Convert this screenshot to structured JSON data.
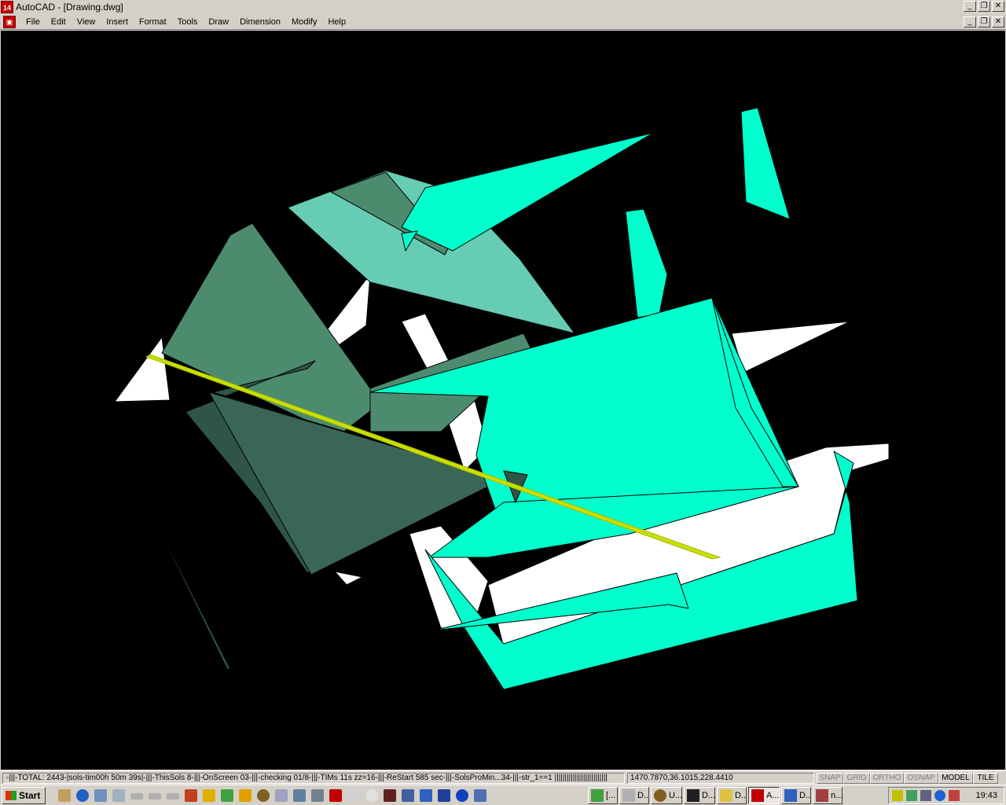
{
  "window": {
    "app_icon_text": "14",
    "title": "AutoCAD - [Drawing.dwg]",
    "controls": {
      "minimize": "_",
      "restore": "❐",
      "close": "✕"
    }
  },
  "menu": {
    "items": [
      {
        "label": "File"
      },
      {
        "label": "Edit"
      },
      {
        "label": "View"
      },
      {
        "label": "Insert"
      },
      {
        "label": "Format"
      },
      {
        "label": "Tools"
      },
      {
        "label": "Draw"
      },
      {
        "label": "Dimension"
      },
      {
        "label": "Modify"
      },
      {
        "label": "Help"
      }
    ]
  },
  "viewport": {
    "background": "#000000",
    "colors": {
      "cyan": "#00ffcc",
      "light_teal": "#66ccb3",
      "medium_green": "#4d8b6f",
      "dark_green": "#2f5546",
      "white": "#ffffff",
      "yellow_green": "#c8e000"
    }
  },
  "status": {
    "message": "-|||-TOTAL: 2443-|sols-tim00h 50m 39s|-|||-ThisSols 8-|||-OnScreen 03-|||-checking 01/8-|||-TIMs 11s zz=16-|||-ReStart 585 sec-|||-SolsProMin...34-|||-str_1==1 ||||||||||||||||||||||||||",
    "coords": "1470.7870,36.1015,228.4410",
    "toggles": [
      {
        "label": "SNAP",
        "on": false
      },
      {
        "label": "GRID",
        "on": false
      },
      {
        "label": "ORTHO",
        "on": false
      },
      {
        "label": "OSNAP",
        "on": false
      },
      {
        "label": "MODEL",
        "on": true
      },
      {
        "label": "TILE",
        "on": true
      }
    ]
  },
  "taskbar": {
    "start_label": "Start",
    "tasks": [
      {
        "label": "[..."
      },
      {
        "label": "D..."
      },
      {
        "label": "U..."
      },
      {
        "label": "D..."
      },
      {
        "label": "D..."
      },
      {
        "label": "A..."
      },
      {
        "label": "D..."
      },
      {
        "label": "n..."
      }
    ],
    "clock": "19:43"
  }
}
